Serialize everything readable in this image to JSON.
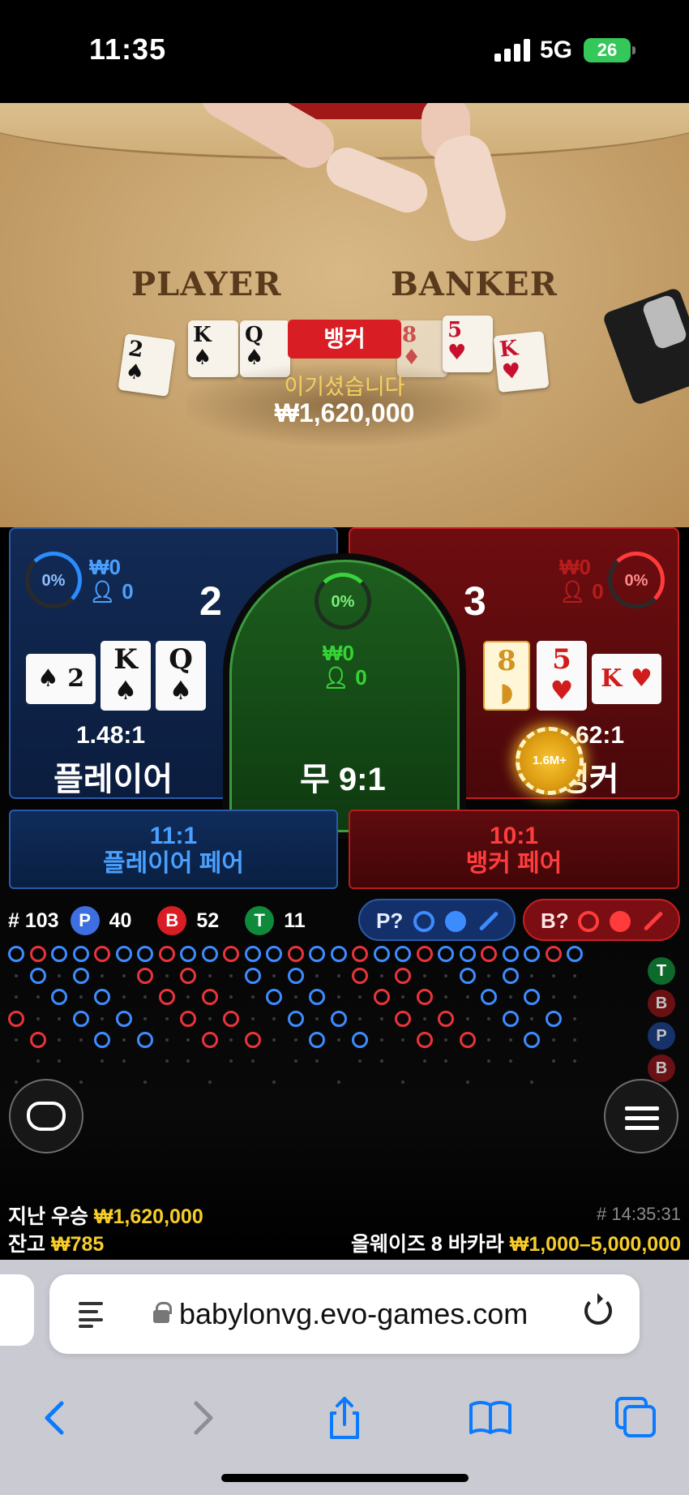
{
  "status_bar": {
    "time": "11:35",
    "network": "5G",
    "battery": "26"
  },
  "table": {
    "player_label": "PLAYER",
    "banker_label": "BANKER",
    "winner_banner": "뱅커",
    "win_message": "이기셨습니다",
    "win_amount": "₩1,620,000",
    "player_cards": [
      {
        "rank": "2",
        "suit": "♠"
      },
      {
        "rank": "K",
        "suit": "♠"
      },
      {
        "rank": "Q",
        "suit": "♠"
      }
    ],
    "banker_cards": [
      {
        "rank": "8",
        "suit": "♦"
      },
      {
        "rank": "5",
        "suit": "♥"
      },
      {
        "rank": "K",
        "suit": "♥"
      }
    ]
  },
  "player_spot": {
    "percent": "0%",
    "bet_amount": "₩0",
    "bettors": "0",
    "score": "2",
    "odds": "1.48:1",
    "name": "플레이어",
    "cards": [
      {
        "rank": "2",
        "suit": "♠",
        "color": "black"
      },
      {
        "rank": "K",
        "suit": "♠",
        "color": "black"
      },
      {
        "rank": "Q",
        "suit": "♠",
        "color": "black"
      }
    ]
  },
  "tie_spot": {
    "percent": "0%",
    "bet_amount": "₩0",
    "bettors": "0",
    "label": "무 9:1"
  },
  "banker_spot": {
    "percent": "0%",
    "bet_amount": "₩0",
    "bettors": "0",
    "score": "3",
    "odds": "62:1",
    "name": "뱅커",
    "chip_label": "1.6M+",
    "cards": [
      {
        "rank": "8",
        "suit": "◗",
        "color": "gold"
      },
      {
        "rank": "5",
        "suit": "♥",
        "color": "red"
      },
      {
        "rank": "K",
        "suit": "♥",
        "color": "red"
      }
    ]
  },
  "pair_bets": {
    "player_odds": "11:1",
    "player_label": "플레이어 페어",
    "banker_odds": "10:1",
    "banker_label": "뱅커 페어"
  },
  "road_stats": {
    "round": "# 103",
    "p_badge": "P",
    "p_count": "40",
    "b_badge": "B",
    "b_count": "52",
    "t_badge": "T",
    "t_count": "11",
    "ask_player": "P?",
    "ask_banker": "B?"
  },
  "colors": {
    "player_blue": "#3d8cff",
    "banker_red": "#e8343a",
    "tie_green": "#2fd13a",
    "gold": "#f7cd2a"
  },
  "side_predictions": [
    "T",
    "B",
    "P",
    "B"
  ],
  "footer": {
    "last_win_label": "지난 우승",
    "last_win_value": "₩1,620,000",
    "balance_label": "잔고",
    "balance_value": "₩785",
    "timestamp": "# 14:35:31",
    "table_name": "올웨이즈 8 바카라",
    "limits": "₩1,000–5,000,000"
  },
  "browser": {
    "url": "babylonvg.evo-games.com"
  }
}
